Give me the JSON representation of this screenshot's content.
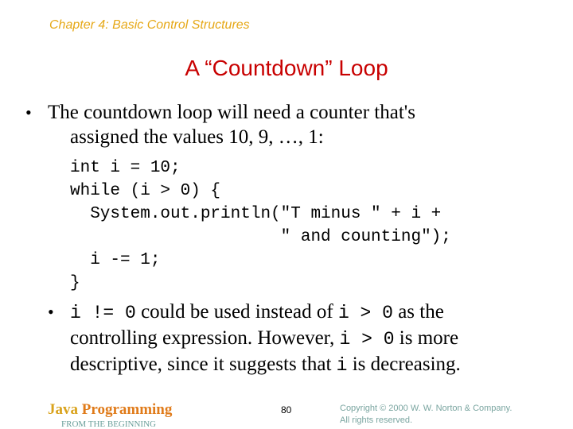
{
  "header": {
    "chapter": "Chapter 4: Basic Control Structures",
    "title": "A “Countdown” Loop"
  },
  "bullets": [
    {
      "icon": "bullet-dot",
      "line1": "The countdown loop will need a counter that's",
      "line2": "assigned the values 10, 9, …, 1:"
    },
    {
      "icon": "bullet-dot",
      "code1": "i != 0",
      "text1": " could be used instead of ",
      "code2": "i > 0",
      "text2": " as the",
      "text3": "controlling expression. However, ",
      "code3": "i > 0",
      "text4": " is more",
      "text5": "descriptive, since it suggests that ",
      "code4": "i",
      "text6": " is decreasing."
    }
  ],
  "code_block": "int i = 10;\nwhile (i > 0) {\n  System.out.println(\"T minus \" + i +\n                     \" and counting\");\n  i -= 1;\n}",
  "footer": {
    "brand_java": "Java",
    "brand_programming": " Programming",
    "subtitle": "FROM THE BEGINNING",
    "page_number": "80",
    "copyright_line1": "Copyright © 2000 W. W. Norton & Company.",
    "copyright_line2": "All rights reserved."
  }
}
